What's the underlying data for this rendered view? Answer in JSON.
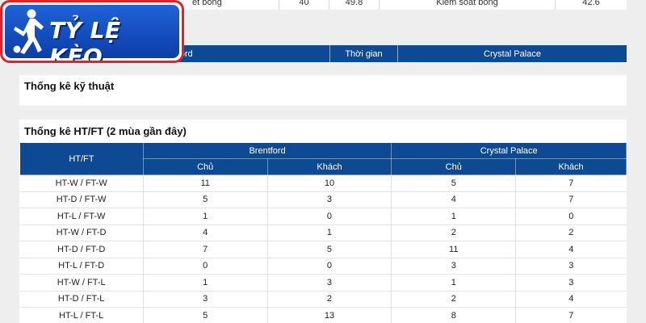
{
  "logo": {
    "text": "TỶ LỆ KÈO",
    "icon": "soccer-player-icon"
  },
  "top_row": {
    "label": "ết bóng",
    "home_value": "40",
    "value2": "49.8",
    "label2": "Kiểm soát bóng",
    "value3": "42.6"
  },
  "match_bar": {
    "home": "Brentford",
    "time": "Thời gian",
    "away": "Crystal Palace"
  },
  "tech_section": {
    "title": "Thống kê kỹ thuật"
  },
  "htft_section": {
    "title": "Thống kê HT/FT (2 mùa gần đây)",
    "col_label": "HT/FT",
    "home_team": "Brentford",
    "away_team": "Crystal Palace",
    "sub_home": "Chủ",
    "sub_away": "Khách",
    "rows": [
      {
        "label": "HT-W / FT-W",
        "v": [
          "11",
          "10",
          "5",
          "7"
        ]
      },
      {
        "label": "HT-D / FT-W",
        "v": [
          "5",
          "3",
          "4",
          "7"
        ]
      },
      {
        "label": "HT-L / FT-W",
        "v": [
          "1",
          "0",
          "1",
          "0"
        ]
      },
      {
        "label": "HT-W / FT-D",
        "v": [
          "4",
          "1",
          "2",
          "2"
        ]
      },
      {
        "label": "HT-D / FT-D",
        "v": [
          "7",
          "5",
          "11",
          "4"
        ]
      },
      {
        "label": "HT-L / FT-D",
        "v": [
          "0",
          "0",
          "3",
          "3"
        ]
      },
      {
        "label": "HT-W / FT-L",
        "v": [
          "1",
          "3",
          "1",
          "3"
        ]
      },
      {
        "label": "HT-D / FT-L",
        "v": [
          "3",
          "2",
          "2",
          "4"
        ]
      },
      {
        "label": "HT-L / FT-L",
        "v": [
          "5",
          "13",
          "8",
          "7"
        ]
      }
    ]
  },
  "colors": {
    "header_blue": "#0d4a93",
    "logo_red": "#e2222b",
    "logo_blue": "#1f62d8"
  }
}
